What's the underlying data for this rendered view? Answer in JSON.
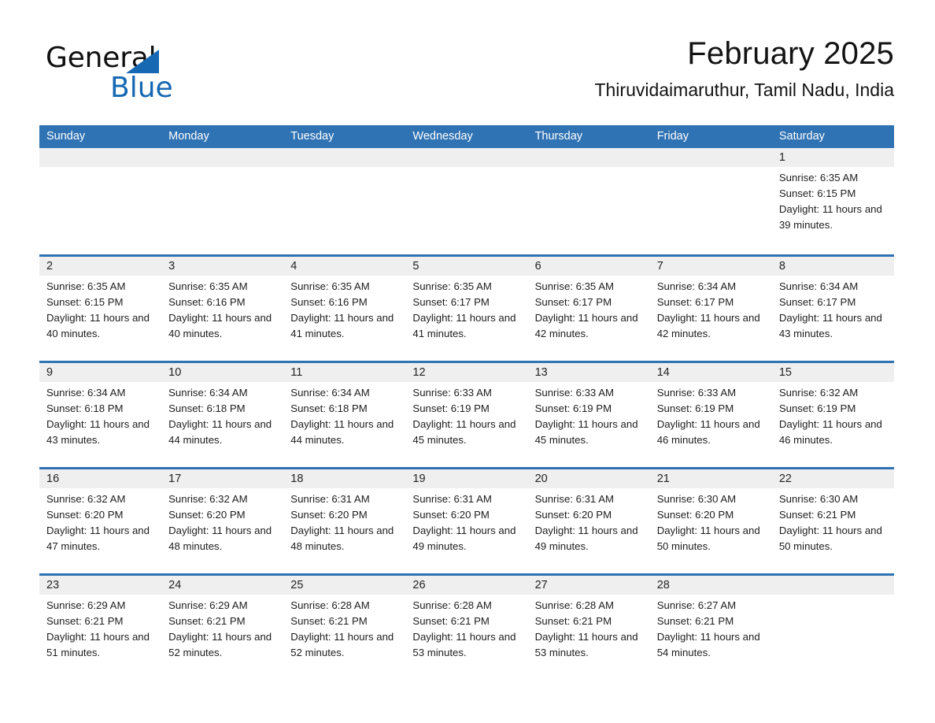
{
  "brand": {
    "word_one": "General",
    "word_two": "Blue",
    "triangle_icon": "triangle-logo-icon",
    "accent_color": "#1668b3"
  },
  "header": {
    "month_title": "February 2025",
    "location": "Thiruvidaimaruthur, Tamil Nadu, India"
  },
  "colors": {
    "header_blue": "#3073b4",
    "row_divider_blue": "#2f72b3",
    "daynum_band": "#efefef",
    "text": "#1d1d1d"
  },
  "calendar": {
    "weekday_headers": [
      "Sunday",
      "Monday",
      "Tuesday",
      "Wednesday",
      "Thursday",
      "Friday",
      "Saturday"
    ],
    "weeks": [
      [
        {
          "day": "",
          "sunrise": "",
          "sunset": "",
          "daylight": ""
        },
        {
          "day": "",
          "sunrise": "",
          "sunset": "",
          "daylight": ""
        },
        {
          "day": "",
          "sunrise": "",
          "sunset": "",
          "daylight": ""
        },
        {
          "day": "",
          "sunrise": "",
          "sunset": "",
          "daylight": ""
        },
        {
          "day": "",
          "sunrise": "",
          "sunset": "",
          "daylight": ""
        },
        {
          "day": "",
          "sunrise": "",
          "sunset": "",
          "daylight": ""
        },
        {
          "day": "1",
          "sunrise": "Sunrise: 6:35 AM",
          "sunset": "Sunset: 6:15 PM",
          "daylight": "Daylight: 11 hours and 39 minutes."
        }
      ],
      [
        {
          "day": "2",
          "sunrise": "Sunrise: 6:35 AM",
          "sunset": "Sunset: 6:15 PM",
          "daylight": "Daylight: 11 hours and 40 minutes."
        },
        {
          "day": "3",
          "sunrise": "Sunrise: 6:35 AM",
          "sunset": "Sunset: 6:16 PM",
          "daylight": "Daylight: 11 hours and 40 minutes."
        },
        {
          "day": "4",
          "sunrise": "Sunrise: 6:35 AM",
          "sunset": "Sunset: 6:16 PM",
          "daylight": "Daylight: 11 hours and 41 minutes."
        },
        {
          "day": "5",
          "sunrise": "Sunrise: 6:35 AM",
          "sunset": "Sunset: 6:17 PM",
          "daylight": "Daylight: 11 hours and 41 minutes."
        },
        {
          "day": "6",
          "sunrise": "Sunrise: 6:35 AM",
          "sunset": "Sunset: 6:17 PM",
          "daylight": "Daylight: 11 hours and 42 minutes."
        },
        {
          "day": "7",
          "sunrise": "Sunrise: 6:34 AM",
          "sunset": "Sunset: 6:17 PM",
          "daylight": "Daylight: 11 hours and 42 minutes."
        },
        {
          "day": "8",
          "sunrise": "Sunrise: 6:34 AM",
          "sunset": "Sunset: 6:17 PM",
          "daylight": "Daylight: 11 hours and 43 minutes."
        }
      ],
      [
        {
          "day": "9",
          "sunrise": "Sunrise: 6:34 AM",
          "sunset": "Sunset: 6:18 PM",
          "daylight": "Daylight: 11 hours and 43 minutes."
        },
        {
          "day": "10",
          "sunrise": "Sunrise: 6:34 AM",
          "sunset": "Sunset: 6:18 PM",
          "daylight": "Daylight: 11 hours and 44 minutes."
        },
        {
          "day": "11",
          "sunrise": "Sunrise: 6:34 AM",
          "sunset": "Sunset: 6:18 PM",
          "daylight": "Daylight: 11 hours and 44 minutes."
        },
        {
          "day": "12",
          "sunrise": "Sunrise: 6:33 AM",
          "sunset": "Sunset: 6:19 PM",
          "daylight": "Daylight: 11 hours and 45 minutes."
        },
        {
          "day": "13",
          "sunrise": "Sunrise: 6:33 AM",
          "sunset": "Sunset: 6:19 PM",
          "daylight": "Daylight: 11 hours and 45 minutes."
        },
        {
          "day": "14",
          "sunrise": "Sunrise: 6:33 AM",
          "sunset": "Sunset: 6:19 PM",
          "daylight": "Daylight: 11 hours and 46 minutes."
        },
        {
          "day": "15",
          "sunrise": "Sunrise: 6:32 AM",
          "sunset": "Sunset: 6:19 PM",
          "daylight": "Daylight: 11 hours and 46 minutes."
        }
      ],
      [
        {
          "day": "16",
          "sunrise": "Sunrise: 6:32 AM",
          "sunset": "Sunset: 6:20 PM",
          "daylight": "Daylight: 11 hours and 47 minutes."
        },
        {
          "day": "17",
          "sunrise": "Sunrise: 6:32 AM",
          "sunset": "Sunset: 6:20 PM",
          "daylight": "Daylight: 11 hours and 48 minutes."
        },
        {
          "day": "18",
          "sunrise": "Sunrise: 6:31 AM",
          "sunset": "Sunset: 6:20 PM",
          "daylight": "Daylight: 11 hours and 48 minutes."
        },
        {
          "day": "19",
          "sunrise": "Sunrise: 6:31 AM",
          "sunset": "Sunset: 6:20 PM",
          "daylight": "Daylight: 11 hours and 49 minutes."
        },
        {
          "day": "20",
          "sunrise": "Sunrise: 6:31 AM",
          "sunset": "Sunset: 6:20 PM",
          "daylight": "Daylight: 11 hours and 49 minutes."
        },
        {
          "day": "21",
          "sunrise": "Sunrise: 6:30 AM",
          "sunset": "Sunset: 6:20 PM",
          "daylight": "Daylight: 11 hours and 50 minutes."
        },
        {
          "day": "22",
          "sunrise": "Sunrise: 6:30 AM",
          "sunset": "Sunset: 6:21 PM",
          "daylight": "Daylight: 11 hours and 50 minutes."
        }
      ],
      [
        {
          "day": "23",
          "sunrise": "Sunrise: 6:29 AM",
          "sunset": "Sunset: 6:21 PM",
          "daylight": "Daylight: 11 hours and 51 minutes."
        },
        {
          "day": "24",
          "sunrise": "Sunrise: 6:29 AM",
          "sunset": "Sunset: 6:21 PM",
          "daylight": "Daylight: 11 hours and 52 minutes."
        },
        {
          "day": "25",
          "sunrise": "Sunrise: 6:28 AM",
          "sunset": "Sunset: 6:21 PM",
          "daylight": "Daylight: 11 hours and 52 minutes."
        },
        {
          "day": "26",
          "sunrise": "Sunrise: 6:28 AM",
          "sunset": "Sunset: 6:21 PM",
          "daylight": "Daylight: 11 hours and 53 minutes."
        },
        {
          "day": "27",
          "sunrise": "Sunrise: 6:28 AM",
          "sunset": "Sunset: 6:21 PM",
          "daylight": "Daylight: 11 hours and 53 minutes."
        },
        {
          "day": "28",
          "sunrise": "Sunrise: 6:27 AM",
          "sunset": "Sunset: 6:21 PM",
          "daylight": "Daylight: 11 hours and 54 minutes."
        },
        {
          "day": "",
          "sunrise": "",
          "sunset": "",
          "daylight": ""
        }
      ]
    ]
  }
}
